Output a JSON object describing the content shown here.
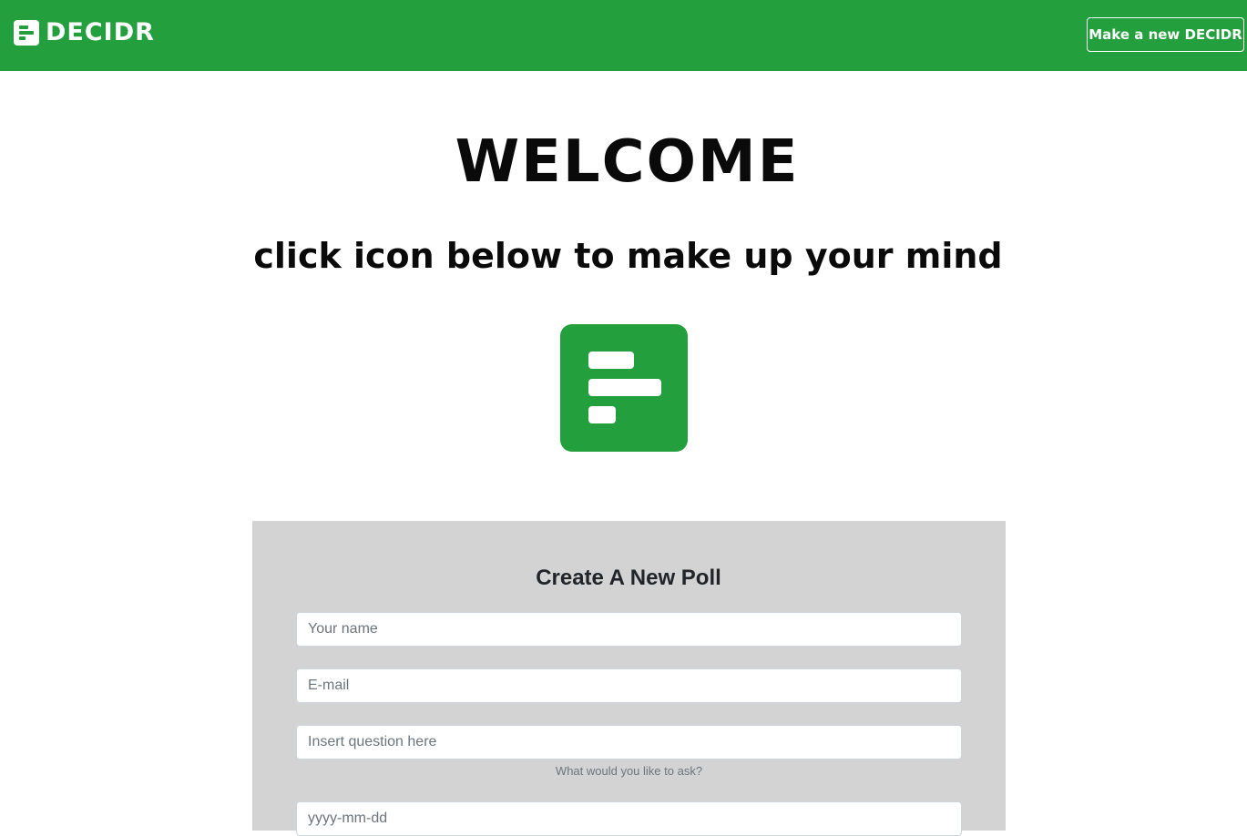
{
  "colors": {
    "brand_green": "#239f3d",
    "panel_gray": "#d3d3d3",
    "text_dark": "#0a0a0a"
  },
  "navbar": {
    "brand_icon": "poll-icon",
    "brand_name": "DECIDR",
    "new_button_label": "Make a new DECIDR"
  },
  "hero": {
    "title": "WELCOME",
    "subtitle": "click icon below to make up your mind",
    "icon": "poll-icon"
  },
  "form": {
    "title": "Create A New Poll",
    "name_placeholder": "Your name",
    "email_placeholder": "E-mail",
    "question_placeholder": "Insert question here",
    "question_help": "What would you like to ask?",
    "date_placeholder": "yyyy-mm-dd"
  }
}
